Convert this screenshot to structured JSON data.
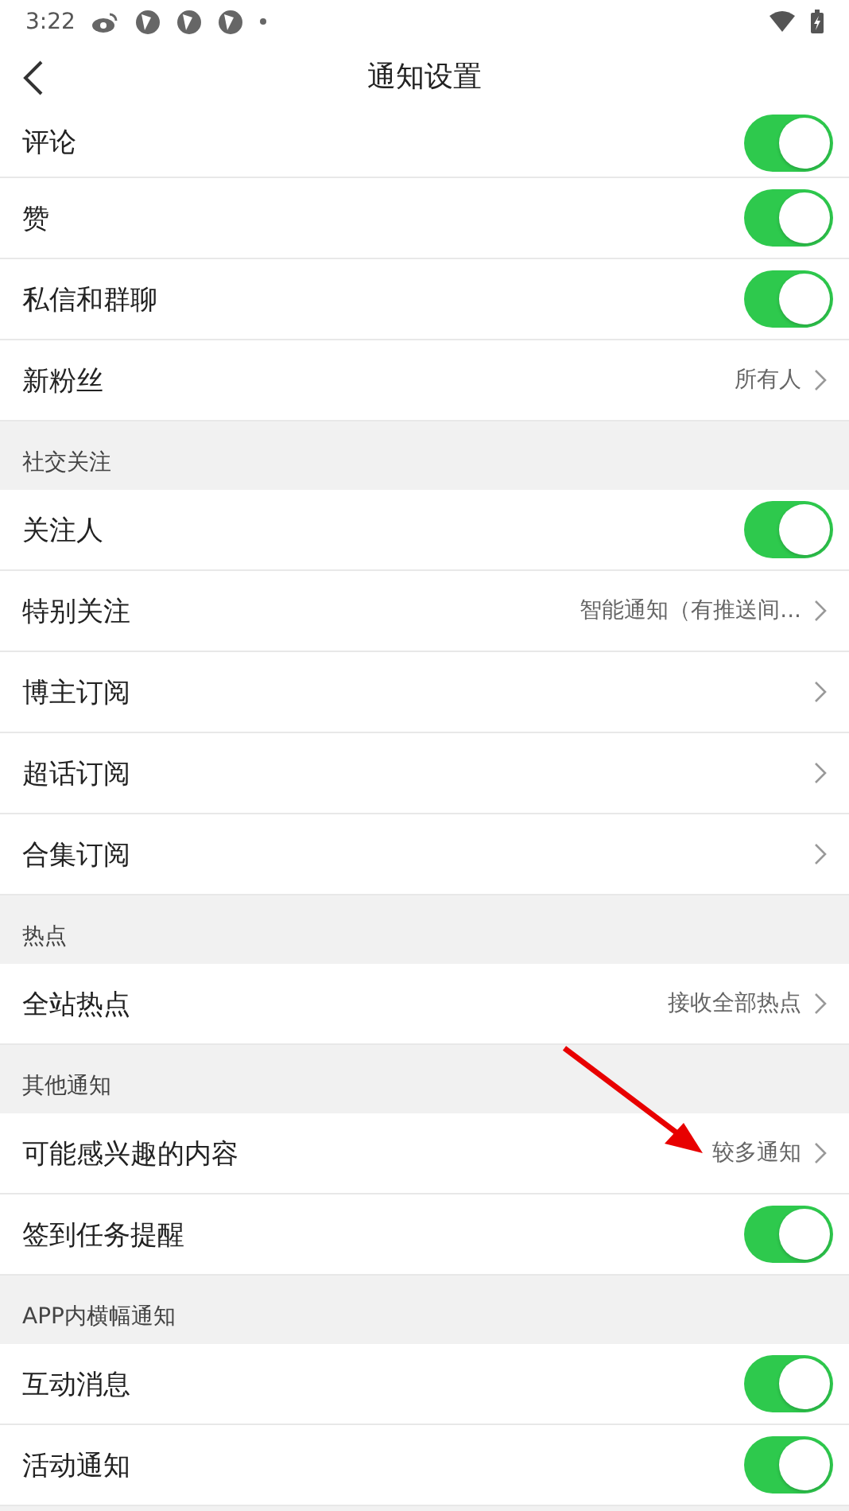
{
  "status_bar": {
    "time": "3:22"
  },
  "header": {
    "title": "通知设置"
  },
  "sections": [
    {
      "items": [
        {
          "label": "评论",
          "kind": "toggle",
          "on": true
        },
        {
          "label": "赞",
          "kind": "toggle",
          "on": true
        },
        {
          "label": "私信和群聊",
          "kind": "toggle",
          "on": true
        },
        {
          "label": "新粉丝",
          "kind": "link",
          "value": "所有人"
        }
      ]
    },
    {
      "title": "社交关注",
      "items": [
        {
          "label": "关注人",
          "kind": "toggle",
          "on": true
        },
        {
          "label": "特别关注",
          "kind": "link",
          "value": "智能通知（有推送间..."
        },
        {
          "label": "博主订阅",
          "kind": "link"
        },
        {
          "label": "超话订阅",
          "kind": "link"
        },
        {
          "label": "合集订阅",
          "kind": "link"
        }
      ]
    },
    {
      "title": "热点",
      "items": [
        {
          "label": "全站热点",
          "kind": "link",
          "value": "接收全部热点"
        }
      ]
    },
    {
      "title": "其他通知",
      "items": [
        {
          "label": "可能感兴趣的内容",
          "kind": "link",
          "value": "较多通知"
        },
        {
          "label": "签到任务提醒",
          "kind": "toggle",
          "on": true
        }
      ]
    },
    {
      "title": "APP内横幅通知",
      "items": [
        {
          "label": "互动消息",
          "kind": "toggle",
          "on": true
        },
        {
          "label": "活动通知",
          "kind": "toggle",
          "on": true
        }
      ]
    }
  ],
  "annotation": {
    "kind": "arrow"
  }
}
